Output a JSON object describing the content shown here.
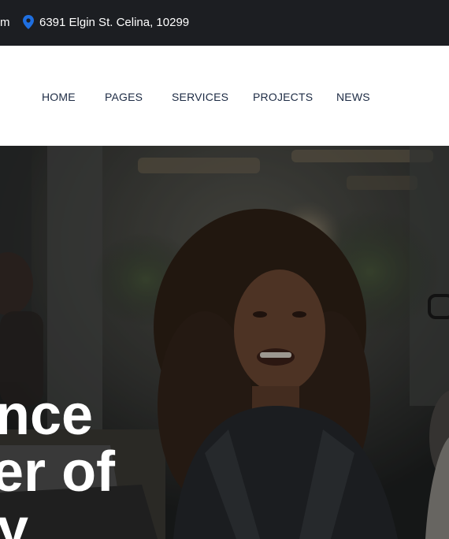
{
  "topbar": {
    "email_tail": "m",
    "location_icon": "map-pin-icon",
    "address": "6391 Elgin St. Celina, 10299"
  },
  "nav": {
    "items": [
      {
        "label": "HOME"
      },
      {
        "label": "PAGES"
      },
      {
        "label": "SERVICES"
      },
      {
        "label": "PROJECTS"
      },
      {
        "label": "NEWS"
      }
    ]
  },
  "hero": {
    "lines": [
      "nce",
      "er of",
      "y"
    ]
  },
  "colors": {
    "topbar_bg": "#1c1e22",
    "nav_text": "#1d2b44",
    "accent": "#1f6fe0"
  }
}
